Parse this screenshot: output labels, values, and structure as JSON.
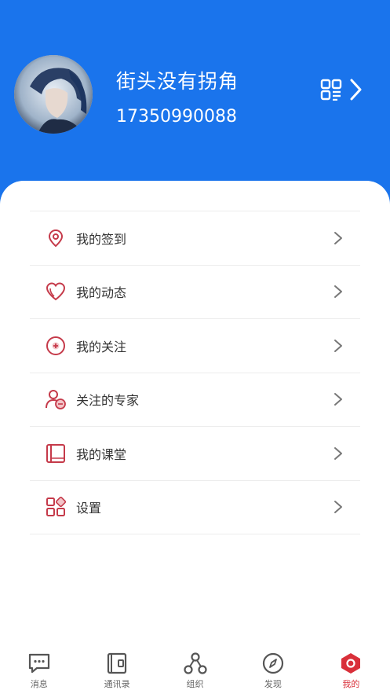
{
  "profile": {
    "username": "街头没有拐角",
    "phone": "17350990088",
    "avatar_icon": "avatar-anime-portrait"
  },
  "header": {
    "qr_icon": "qr-code-icon",
    "chevron_icon": "chevron-right-icon"
  },
  "colors": {
    "header_bg": "#1a74ec",
    "accent": "#d9303a",
    "icon_red": "#c53a4a"
  },
  "menu": [
    {
      "label": "我的签到",
      "icon": "location-pin-icon"
    },
    {
      "label": "我的动态",
      "icon": "heart-icon"
    },
    {
      "label": "我的关注",
      "icon": "plus-circle-icon"
    },
    {
      "label": "关注的专家",
      "icon": "expert-user-icon"
    },
    {
      "label": "我的课堂",
      "icon": "book-icon"
    },
    {
      "label": "设置",
      "icon": "settings-grid-icon"
    }
  ],
  "tabbar": [
    {
      "label": "消息",
      "icon": "message-icon",
      "active": false
    },
    {
      "label": "通讯录",
      "icon": "contacts-icon",
      "active": false
    },
    {
      "label": "组织",
      "icon": "organization-icon",
      "active": false
    },
    {
      "label": "发现",
      "icon": "compass-icon",
      "active": false
    },
    {
      "label": "我的",
      "icon": "profile-hexagon-icon",
      "active": true
    }
  ]
}
